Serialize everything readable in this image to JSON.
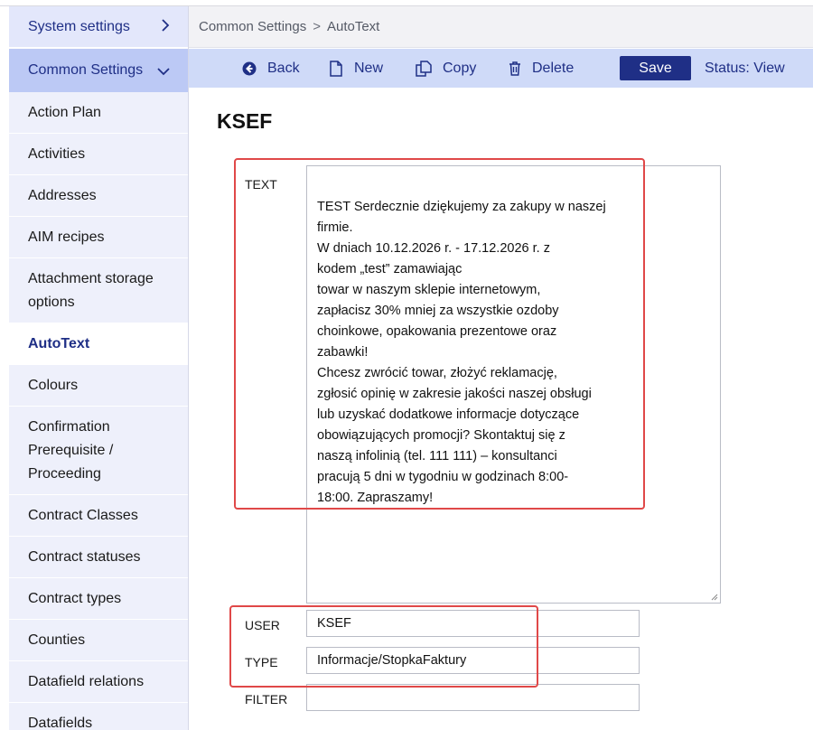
{
  "sidebar": {
    "system_settings": "System settings",
    "common_settings": "Common Settings",
    "items": [
      {
        "label": "Action Plan"
      },
      {
        "label": "Activities"
      },
      {
        "label": "Addresses"
      },
      {
        "label": "AIM recipes"
      },
      {
        "label": "Attachment storage options"
      },
      {
        "label": "AutoText",
        "active": true
      },
      {
        "label": "Colours"
      },
      {
        "label": "Confirmation Prerequisite / Proceeding"
      },
      {
        "label": "Contract Classes"
      },
      {
        "label": "Contract statuses"
      },
      {
        "label": "Contract types"
      },
      {
        "label": "Counties"
      },
      {
        "label": "Datafield relations"
      },
      {
        "label": "Datafields"
      }
    ]
  },
  "breadcrumb": {
    "parent": "Common Settings",
    "separator": ">",
    "current": "AutoText"
  },
  "toolbar": {
    "back_label": "Back",
    "new_label": "New",
    "copy_label": "Copy",
    "delete_label": "Delete",
    "save_label": "Save",
    "status_label": "Status: View"
  },
  "form": {
    "title": "KSEF",
    "text_label": "TEXT",
    "text_value": "TEST Serdecznie dziękujemy za zakupy w naszej\nfirmie.\nW dniach 10.12.2026 r. - 17.12.2026 r. z\nkodem „test” zamawiając\ntowar w naszym sklepie internetowym,\nzapłacisz 30% mniej za wszystkie ozdoby\nchoinkowe, opakowania prezentowe oraz\nzabawki!\nChcesz zwrócić towar, złożyć reklamację,\nzgłosić opinię w zakresie jakości naszej obsługi\nlub uzyskać dodatkowe informacje dotyczące\nobowiązujących promocji? Skontaktuj się z\nnaszą infolinią (tel. 111 111) – konsultanci\npracują 5 dni w tygodniu w godzinach 8:00-\n18:00. Zapraszamy!",
    "user_label": "USER",
    "user_value": "KSEF",
    "type_label": "TYPE",
    "type_value": "Informacje/StopkaFaktury",
    "filter_label": "FILTER",
    "filter_value": ""
  },
  "colors": {
    "accent": "#1f2f86",
    "highlight": "#e04848",
    "toolbar": "#cfdaf8",
    "sidebar_active_group": "#bcc9f5"
  }
}
